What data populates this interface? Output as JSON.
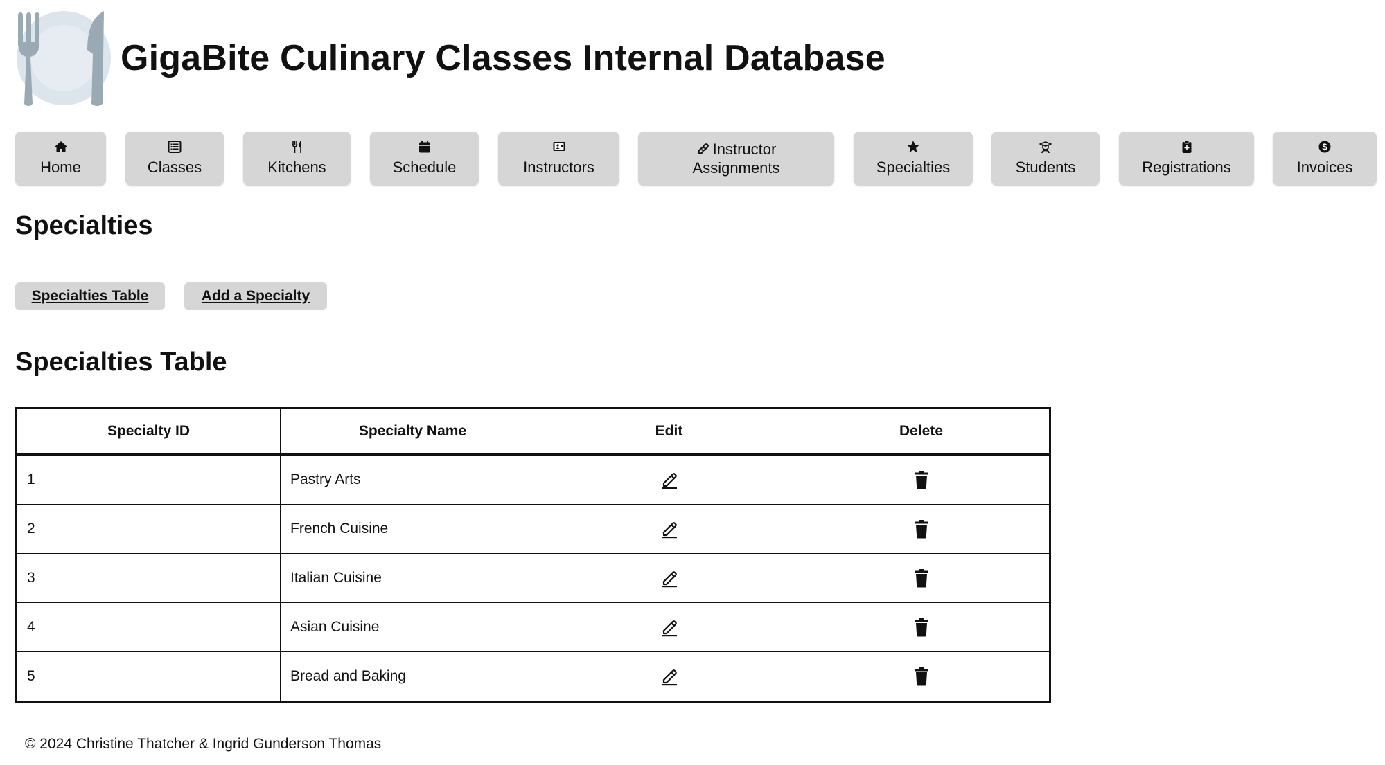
{
  "site": {
    "title": "GigaBite Culinary Classes Internal Database",
    "logo_icon": "plate-fork-knife-icon",
    "colors": {
      "logo_plate": "#dde5ec",
      "logo_utensil": "#99aab5",
      "button_bg": "#d6d6d6"
    }
  },
  "nav": {
    "items": [
      {
        "label": "Home",
        "icon": "house-icon"
      },
      {
        "label": "Classes",
        "icon": "list-icon"
      },
      {
        "label": "Kitchens",
        "icon": "utensils-icon"
      },
      {
        "label": "Schedule",
        "icon": "calendar-icon"
      },
      {
        "label": "Instructors",
        "icon": "presentation-icon"
      },
      {
        "label_line1": "Instructor",
        "label_line2": "Assignments",
        "icon": "link-icon"
      },
      {
        "label": "Specialties",
        "icon": "star-icon"
      },
      {
        "label": "Students",
        "icon": "graduate-icon"
      },
      {
        "label": "Registrations",
        "icon": "clipboard-icon"
      },
      {
        "label": "Invoices",
        "icon": "dollar-icon"
      }
    ]
  },
  "page": {
    "title": "Specialties",
    "subnav": {
      "table_link": "Specialties Table",
      "add_link": "Add a Specialty"
    },
    "table_title": "Specialties Table"
  },
  "table": {
    "headers": [
      "Specialty ID",
      "Specialty Name",
      "Edit",
      "Delete"
    ],
    "edit_icon": "pencil-icon",
    "delete_icon": "trash-icon",
    "rows": [
      {
        "id": "1",
        "name": "Pastry Arts"
      },
      {
        "id": "2",
        "name": "French Cuisine"
      },
      {
        "id": "3",
        "name": "Italian Cuisine"
      },
      {
        "id": "4",
        "name": "Asian Cuisine"
      },
      {
        "id": "5",
        "name": "Bread and Baking"
      }
    ]
  },
  "footer": {
    "text": "© 2024 Christine Thatcher & Ingrid Gunderson Thomas"
  }
}
